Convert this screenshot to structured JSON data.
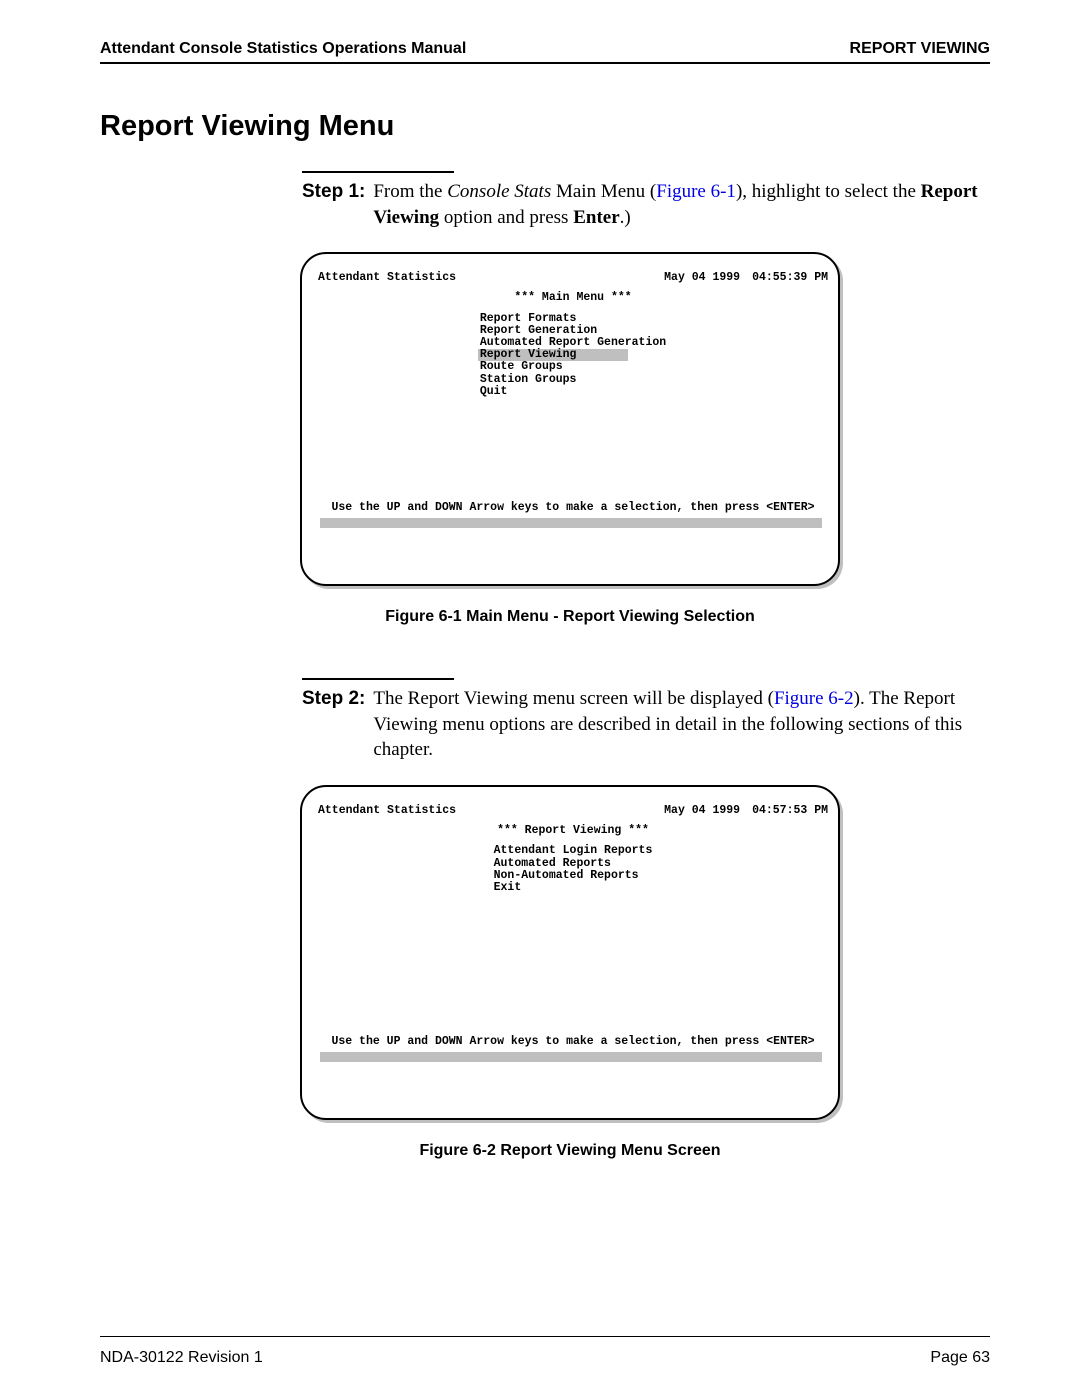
{
  "header": {
    "left": "Attendant Console Statistics Operations Manual",
    "right": "REPORT VIEWING"
  },
  "section_title": "Report Viewing Menu",
  "step1": {
    "label": "Step 1:",
    "pre": "From the ",
    "italic": "Console Stats",
    "mid1": " Main Menu (",
    "link": "Figure 6-1",
    "mid2": "), highlight to select the ",
    "bold1": "Report Viewing",
    "mid3": " option and press ",
    "bold2": "Enter",
    "end": ".)"
  },
  "fig1": {
    "app": "Attendant Statistics",
    "date": "May 04 1999",
    "time": "04:55:39 PM",
    "title": "*** Main Menu ***",
    "items": [
      "Report Formats",
      "Report Generation",
      "Automated Report Generation",
      "Report Viewing",
      "Route Groups",
      "Station Groups",
      "Quit"
    ],
    "highlight_index": 3,
    "help": "Use the UP and DOWN Arrow keys to make a selection, then press <ENTER>",
    "caption": "Figure 6-1   Main Menu - Report Viewing Selection"
  },
  "step2": {
    "label": "Step 2:",
    "pre": "The Report Viewing menu screen will be displayed (",
    "link": "Figure 6-2",
    "mid": "). The Report Viewing menu options are described in detail in the following sections of this chapter."
  },
  "fig2": {
    "app": "Attendant Statistics",
    "date": "May 04 1999",
    "time": "04:57:53 PM",
    "title": "*** Report Viewing ***",
    "items": [
      "Attendant Login Reports",
      "Automated Reports",
      "Non-Automated Reports",
      "Exit"
    ],
    "help": "Use the UP and DOWN Arrow keys to make a selection, then press <ENTER>",
    "caption": "Figure 6-2   Report Viewing Menu Screen"
  },
  "footer": {
    "left": "NDA-30122   Revision 1",
    "right": "Page 63"
  }
}
